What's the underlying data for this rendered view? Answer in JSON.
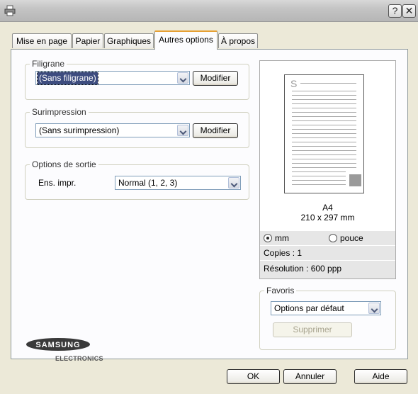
{
  "window": {
    "help_glyph": "?",
    "close_glyph": "✕"
  },
  "tabs": [
    {
      "label": "Mise en page"
    },
    {
      "label": "Papier"
    },
    {
      "label": "Graphiques"
    },
    {
      "label": "Autres options"
    },
    {
      "label": "À propos"
    }
  ],
  "active_tab": "Autres options",
  "filigrane": {
    "legend": "Filigrane",
    "value": "(Sans filigrane)",
    "button": "Modifier"
  },
  "surimpression": {
    "legend": "Surimpression",
    "value": "(Sans surimpression)",
    "button": "Modifier"
  },
  "options_sortie": {
    "legend": "Options de sortie",
    "label": "Ens. impr.",
    "value": "Normal (1, 2, 3)"
  },
  "preview": {
    "page_letter": "S",
    "paper_name": "A4",
    "paper_size": "210 x 297 mm",
    "unit_mm": "mm",
    "unit_inch": "pouce",
    "selected_unit": "mm",
    "copies": "Copies : 1",
    "resolution": "Résolution : 600 ppp"
  },
  "favoris": {
    "legend": "Favoris",
    "value": "Options par défaut",
    "delete_button": "Supprimer"
  },
  "logo": {
    "brand": "SAMSUNG",
    "sub": "ELECTRONICS"
  },
  "footer": {
    "ok": "OK",
    "cancel": "Annuler",
    "help": "Aide"
  }
}
